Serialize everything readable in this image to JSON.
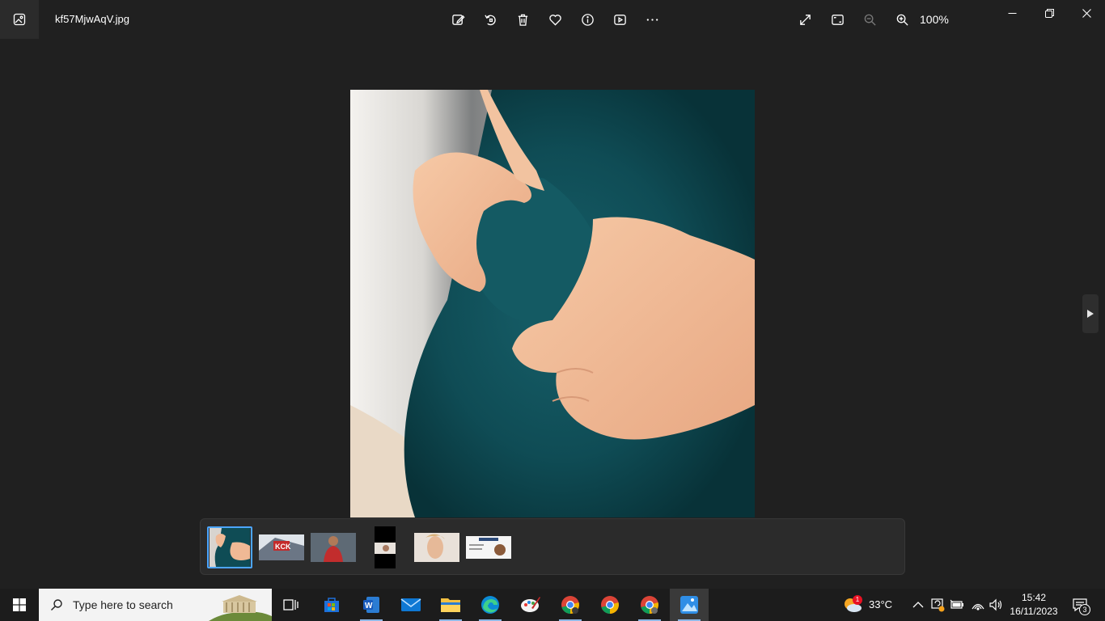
{
  "titlebar": {
    "filename": "kf57MjwAqV.jpg",
    "zoom": "100%"
  },
  "toolbar": {
    "center_icons": [
      "edit-icon",
      "rotate-icon",
      "delete-icon",
      "favorite-icon",
      "info-icon",
      "slideshow-icon",
      "more-icon"
    ],
    "right_icons": [
      "fullscreen-icon",
      "fit-icon",
      "zoom-out-icon",
      "zoom-in-icon"
    ]
  },
  "filmstrip": {
    "thumbs": [
      "pregnant-belly",
      "banner",
      "football-player",
      "portrait",
      "woman-face",
      "document"
    ],
    "selected_index": 0
  },
  "taskbar": {
    "search_placeholder": "Type here to search",
    "weather": "33°C",
    "weather_badge": "1",
    "time": "15:42",
    "date": "16/11/2023",
    "notifications": "3",
    "apps": [
      "task-view",
      "microsoft-store",
      "word",
      "mail",
      "file-explorer",
      "edge",
      "paint",
      "chrome",
      "chrome",
      "chrome",
      "photos"
    ]
  },
  "colors": {
    "accent": "#4ca6ff",
    "background": "#202020",
    "shirt": "#0f4a52"
  }
}
